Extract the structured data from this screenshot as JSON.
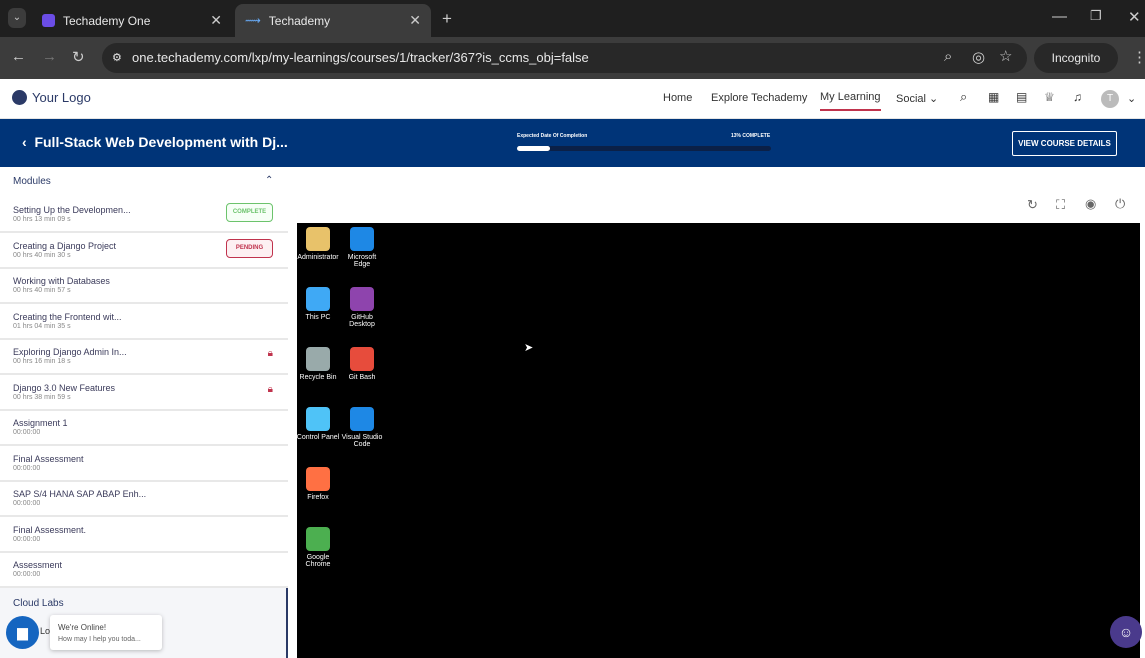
{
  "browser": {
    "tabs": [
      {
        "label": "Techademy One"
      },
      {
        "label": "Techademy"
      }
    ],
    "url": "one.techademy.com/lxp/my-learnings/courses/1/tracker/367?is_ccms_obj=false",
    "incognito": "Incognito"
  },
  "site": {
    "logo": "Your Logo",
    "nav": [
      "Home",
      "Explore Techademy",
      "My Learning",
      "Social"
    ],
    "avatar": "T"
  },
  "banner": {
    "title": "Full-Stack Web Development with Dj...",
    "expected_label": "Expected Date Of Completion",
    "percent_label": "13% COMPLETE",
    "progress": 13,
    "button": "VIEW COURSE DETAILS"
  },
  "sidebar": {
    "heading": "Modules",
    "modules": [
      {
        "title": "Setting Up the Developmen...",
        "duration": "00 hrs 13 min 09 s",
        "status": "COMPLETE"
      },
      {
        "title": "Creating a Django Project",
        "duration": "00 hrs 40 min 30 s",
        "status": "PENDING"
      },
      {
        "title": "Working with Databases",
        "duration": "00 hrs 40 min 57 s"
      },
      {
        "title": "Creating the Frontend wit...",
        "duration": "01 hrs 04 min 35 s"
      },
      {
        "title": "Exploring Django Admin In...",
        "duration": "00 hrs 16 min 18 s",
        "locked": true
      },
      {
        "title": "Django 3.0 New Features",
        "duration": "00 hrs 38 min 59 s",
        "locked": true
      },
      {
        "title": "Assignment 1",
        "duration": "00:00:00"
      },
      {
        "title": "Final Assessment",
        "duration": "00:00:00"
      },
      {
        "title": "SAP S/4 HANA SAP ABAP Enh...",
        "duration": "00:00:00"
      },
      {
        "title": "Final Assessment.",
        "duration": "00:00:00"
      },
      {
        "title": "Assessment",
        "duration": "00:00:00"
      }
    ],
    "cloud_labs": "Cloud Labs",
    "cloud_sub": "Lo"
  },
  "chat": {
    "title": "We're Online!",
    "subtitle": "How may I help you toda..."
  },
  "desktop": {
    "icons": [
      [
        "Administrator",
        "Microsoft Edge"
      ],
      [
        "This PC",
        "GitHub Desktop"
      ],
      [
        "Recycle Bin",
        "Git Bash"
      ],
      [
        "Control Panel",
        "Visual Studio Code"
      ],
      [
        "Firefox"
      ],
      [
        "Google Chrome"
      ]
    ]
  }
}
